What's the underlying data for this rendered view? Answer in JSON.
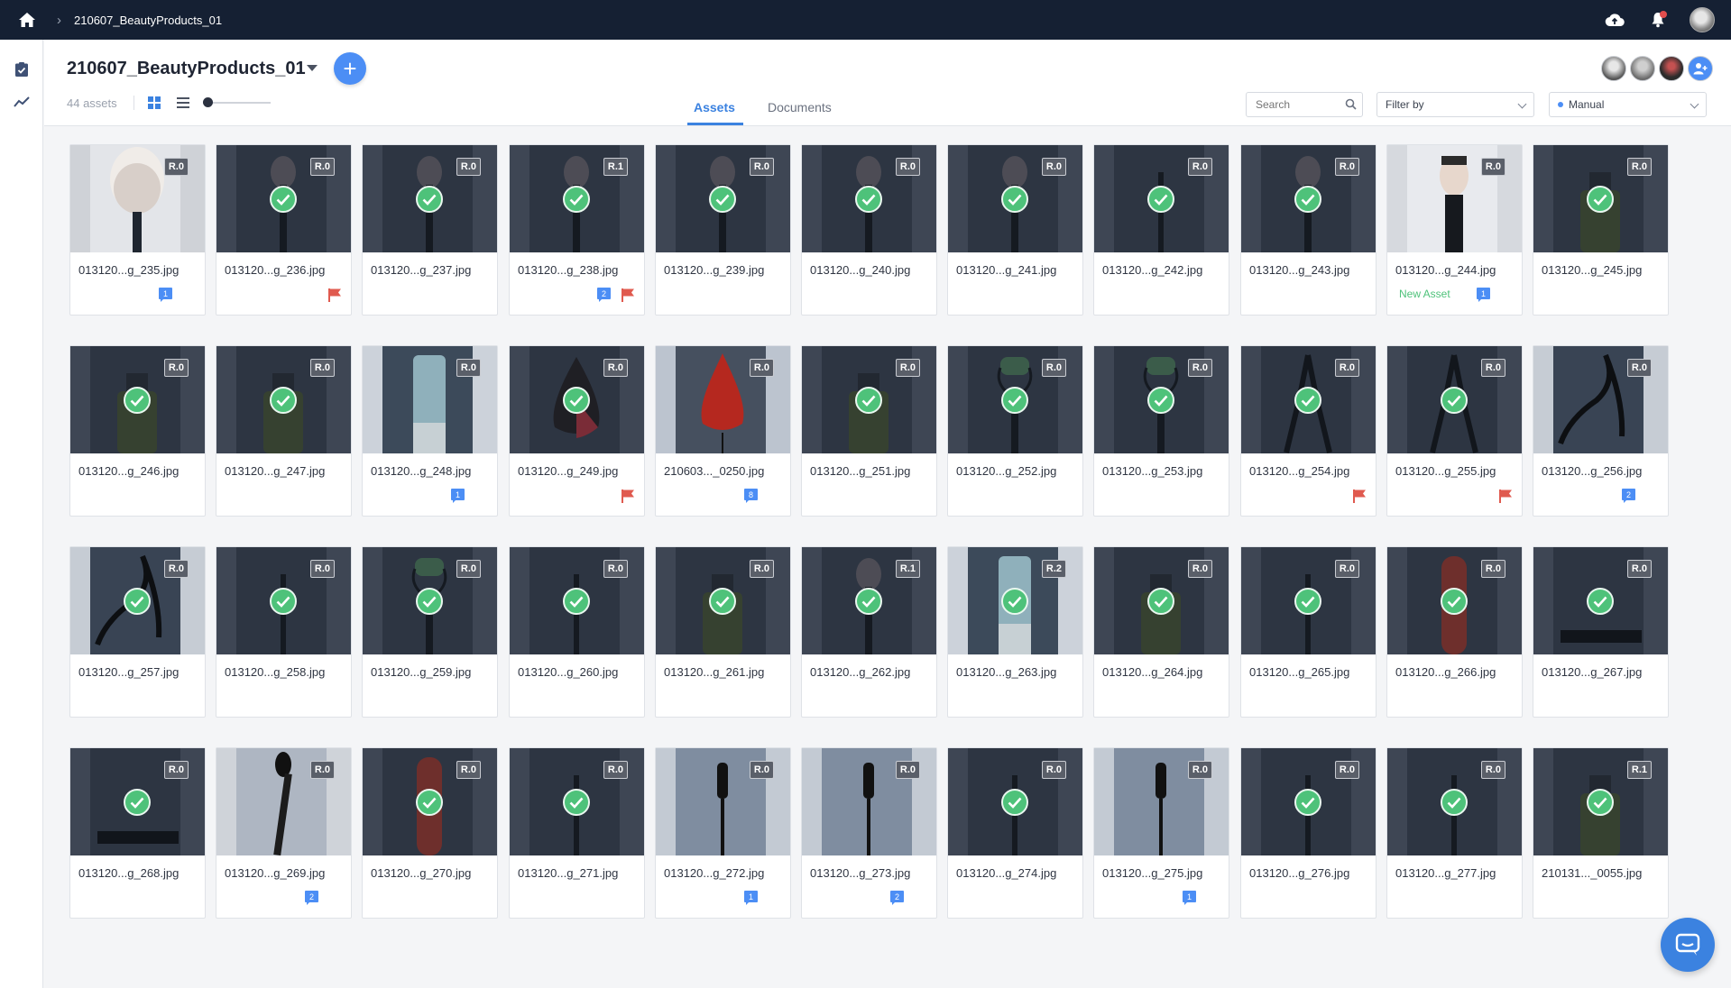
{
  "topbar": {
    "breadcrumb": "210607_BeautyProducts_01"
  },
  "header": {
    "title": "210607_BeautyProducts_01",
    "asset_count": "44 assets",
    "tabs": [
      {
        "label": "Assets",
        "active": true
      },
      {
        "label": "Documents",
        "active": false
      }
    ],
    "search_placeholder": "Search",
    "filter_label": "Filter by",
    "sort_label": "Manual"
  },
  "colors": {
    "accent": "#4c8ef5",
    "approved": "#4ec27a",
    "flag": "#e05a4f",
    "topbar": "#152033"
  },
  "assets": [
    {
      "name": "013120...g_235.jpg",
      "rev": "R.0",
      "approved": false,
      "comments": "1",
      "flag": false,
      "new": false,
      "shot": "brush-big"
    },
    {
      "name": "013120...g_236.jpg",
      "rev": "R.0",
      "approved": true,
      "comments": "",
      "flag": true,
      "new": false,
      "shot": "brush"
    },
    {
      "name": "013120...g_237.jpg",
      "rev": "R.0",
      "approved": true,
      "comments": "",
      "flag": false,
      "new": false,
      "shot": "brush"
    },
    {
      "name": "013120...g_238.jpg",
      "rev": "R.1",
      "approved": true,
      "comments": "2",
      "flag": true,
      "new": false,
      "shot": "brush"
    },
    {
      "name": "013120...g_239.jpg",
      "rev": "R.0",
      "approved": true,
      "comments": "",
      "flag": false,
      "new": false,
      "shot": "brush"
    },
    {
      "name": "013120...g_240.jpg",
      "rev": "R.0",
      "approved": true,
      "comments": "",
      "flag": false,
      "new": false,
      "shot": "brush"
    },
    {
      "name": "013120...g_241.jpg",
      "rev": "R.0",
      "approved": true,
      "comments": "",
      "flag": false,
      "new": false,
      "shot": "brush"
    },
    {
      "name": "013120...g_242.jpg",
      "rev": "R.0",
      "approved": true,
      "comments": "",
      "flag": false,
      "new": false,
      "shot": "stick"
    },
    {
      "name": "013120...g_243.jpg",
      "rev": "R.0",
      "approved": true,
      "comments": "",
      "flag": false,
      "new": false,
      "shot": "brush"
    },
    {
      "name": "013120...g_244.jpg",
      "rev": "R.0",
      "approved": false,
      "comments": "1",
      "flag": false,
      "new": true,
      "new_label": "New Asset",
      "shot": "brush-light"
    },
    {
      "name": "013120...g_245.jpg",
      "rev": "R.0",
      "approved": true,
      "comments": "",
      "flag": false,
      "new": false,
      "shot": "bottle"
    },
    {
      "name": "013120...g_246.jpg",
      "rev": "R.0",
      "approved": true,
      "comments": "",
      "flag": false,
      "new": false,
      "shot": "bottle"
    },
    {
      "name": "013120...g_247.jpg",
      "rev": "R.0",
      "approved": true,
      "comments": "",
      "flag": false,
      "new": false,
      "shot": "bottle"
    },
    {
      "name": "013120...g_248.jpg",
      "rev": "R.0",
      "approved": false,
      "comments": "1",
      "flag": false,
      "new": false,
      "shot": "tube"
    },
    {
      "name": "013120...g_249.jpg",
      "rev": "R.0",
      "approved": true,
      "comments": "",
      "flag": true,
      "new": false,
      "shot": "sponge"
    },
    {
      "name": "210603..._0250.jpg",
      "rev": "R.0",
      "approved": false,
      "comments": "8",
      "flag": false,
      "new": false,
      "shot": "sponge-red"
    },
    {
      "name": "013120...g_251.jpg",
      "rev": "R.0",
      "approved": true,
      "comments": "",
      "flag": false,
      "new": false,
      "shot": "bottle"
    },
    {
      "name": "013120...g_252.jpg",
      "rev": "R.0",
      "approved": true,
      "comments": "",
      "flag": false,
      "new": false,
      "shot": "roller"
    },
    {
      "name": "013120...g_253.jpg",
      "rev": "R.0",
      "approved": true,
      "comments": "",
      "flag": false,
      "new": false,
      "shot": "roller"
    },
    {
      "name": "013120...g_254.jpg",
      "rev": "R.0",
      "approved": true,
      "comments": "",
      "flag": true,
      "new": false,
      "shot": "clipper"
    },
    {
      "name": "013120...g_255.jpg",
      "rev": "R.0",
      "approved": true,
      "comments": "",
      "flag": true,
      "new": false,
      "shot": "clipper"
    },
    {
      "name": "013120...g_256.jpg",
      "rev": "R.0",
      "approved": false,
      "comments": "2",
      "flag": false,
      "new": false,
      "shot": "curler"
    },
    {
      "name": "013120...g_257.jpg",
      "rev": "R.0",
      "approved": true,
      "comments": "",
      "flag": false,
      "new": false,
      "shot": "curler"
    },
    {
      "name": "013120...g_258.jpg",
      "rev": "R.0",
      "approved": true,
      "comments": "",
      "flag": false,
      "new": false,
      "shot": "stick"
    },
    {
      "name": "013120...g_259.jpg",
      "rev": "R.0",
      "approved": true,
      "comments": "",
      "flag": false,
      "new": false,
      "shot": "roller"
    },
    {
      "name": "013120...g_260.jpg",
      "rev": "R.0",
      "approved": true,
      "comments": "",
      "flag": false,
      "new": false,
      "shot": "stick"
    },
    {
      "name": "013120...g_261.jpg",
      "rev": "R.0",
      "approved": true,
      "comments": "",
      "flag": false,
      "new": false,
      "shot": "bottle"
    },
    {
      "name": "013120...g_262.jpg",
      "rev": "R.1",
      "approved": true,
      "comments": "",
      "flag": false,
      "new": false,
      "shot": "brush"
    },
    {
      "name": "013120...g_263.jpg",
      "rev": "R.2",
      "approved": true,
      "comments": "",
      "flag": false,
      "new": false,
      "shot": "tube"
    },
    {
      "name": "013120...g_264.jpg",
      "rev": "R.0",
      "approved": true,
      "comments": "",
      "flag": false,
      "new": false,
      "shot": "bottle"
    },
    {
      "name": "013120...g_265.jpg",
      "rev": "R.0",
      "approved": true,
      "comments": "",
      "flag": false,
      "new": false,
      "shot": "stick"
    },
    {
      "name": "013120...g_266.jpg",
      "rev": "R.0",
      "approved": true,
      "comments": "",
      "flag": false,
      "new": false,
      "shot": "file"
    },
    {
      "name": "013120...g_267.jpg",
      "rev": "R.0",
      "approved": true,
      "comments": "",
      "flag": false,
      "new": false,
      "shot": "box"
    },
    {
      "name": "013120...g_268.jpg",
      "rev": "R.0",
      "approved": true,
      "comments": "",
      "flag": false,
      "new": false,
      "shot": "box"
    },
    {
      "name": "013120...g_269.jpg",
      "rev": "R.0",
      "approved": false,
      "comments": "2",
      "flag": false,
      "new": false,
      "shot": "stick-light"
    },
    {
      "name": "013120...g_270.jpg",
      "rev": "R.0",
      "approved": true,
      "comments": "",
      "flag": false,
      "new": false,
      "shot": "file"
    },
    {
      "name": "013120...g_271.jpg",
      "rev": "R.0",
      "approved": true,
      "comments": "",
      "flag": false,
      "new": false,
      "shot": "stick"
    },
    {
      "name": "013120...g_272.jpg",
      "rev": "R.0",
      "approved": false,
      "comments": "1",
      "flag": false,
      "new": false,
      "shot": "mascara"
    },
    {
      "name": "013120...g_273.jpg",
      "rev": "R.0",
      "approved": false,
      "comments": "2",
      "flag": false,
      "new": false,
      "shot": "mascara"
    },
    {
      "name": "013120...g_274.jpg",
      "rev": "R.0",
      "approved": true,
      "comments": "",
      "flag": false,
      "new": false,
      "shot": "stick"
    },
    {
      "name": "013120...g_275.jpg",
      "rev": "R.0",
      "approved": false,
      "comments": "1",
      "flag": false,
      "new": false,
      "shot": "mascara"
    },
    {
      "name": "013120...g_276.jpg",
      "rev": "R.0",
      "approved": true,
      "comments": "",
      "flag": false,
      "new": false,
      "shot": "stick"
    },
    {
      "name": "013120...g_277.jpg",
      "rev": "R.0",
      "approved": true,
      "comments": "",
      "flag": false,
      "new": false,
      "shot": "stick"
    },
    {
      "name": "210131..._0055.jpg",
      "rev": "R.1",
      "approved": true,
      "comments": "",
      "flag": false,
      "new": false,
      "shot": "bottle"
    }
  ]
}
